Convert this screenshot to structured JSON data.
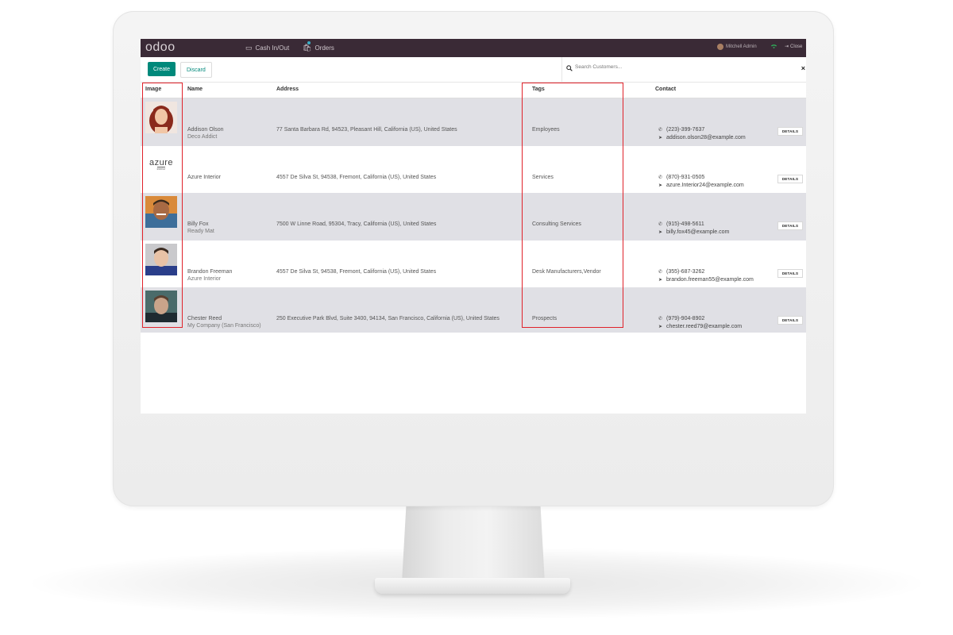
{
  "app": {
    "logo": "odoo"
  },
  "topbar": {
    "cash": "Cash In/Out",
    "orders": "Orders",
    "user": "Mitchell Admin",
    "close": "Close"
  },
  "controls": {
    "create": "Create",
    "discard": "Discard",
    "search_placeholder": "Search Customers..."
  },
  "table": {
    "headers": {
      "image": "Image",
      "name": "Name",
      "address": "Address",
      "tags": "Tags",
      "contact": "Contact"
    },
    "details_label": "DETAILS",
    "rows": [
      {
        "name": "Addison Olson",
        "company": "Deco Addict",
        "address": "77 Santa Barbara Rd, 94523, Pleasant Hill, California (US), United States",
        "tags": "Employees",
        "phone": "(223)-399-7637",
        "email": "addison.olson28@example.com",
        "image": "woman-portrait"
      },
      {
        "name": "Azure Interior",
        "company": "",
        "address": "4557 De Silva St, 94538, Fremont, California (US), United States",
        "tags": "Services",
        "phone": "(870)-931-0505",
        "email": "azure.Interior24@example.com",
        "image": "azure-logo",
        "logo_text": "azure",
        "logo_sub": "interior"
      },
      {
        "name": "Billy Fox",
        "company": "Ready Mat",
        "address": "7500 W Linne Road, 95304, Tracy, California (US), United States",
        "tags": "Consulting Services",
        "phone": "(915)-498-5611",
        "email": "billy.fox45@example.com",
        "image": "man-portrait"
      },
      {
        "name": "Brandon Freeman",
        "company": "Azure Interior",
        "address": "4557 De Silva St, 94538, Fremont, California (US), United States",
        "tags": "Desk Manufacturers,Vendor",
        "phone": "(355)-687-3262",
        "email": "brandon.freeman55@example.com",
        "image": "man-portrait"
      },
      {
        "name": "Chester Reed",
        "company": "My Company (San Francisco)",
        "address": "250 Executive Park Blvd, Suite 3400, 94134, San Francisco, California (US), United States",
        "tags": "Prospects",
        "phone": "(979)-904-8902",
        "email": "chester.reed79@example.com",
        "image": "man-portrait"
      }
    ]
  },
  "colors": {
    "topbar": "#3a2a36",
    "accent": "#00897b",
    "row_alt": "#e0e0e5",
    "highlight": "#e0222a"
  }
}
